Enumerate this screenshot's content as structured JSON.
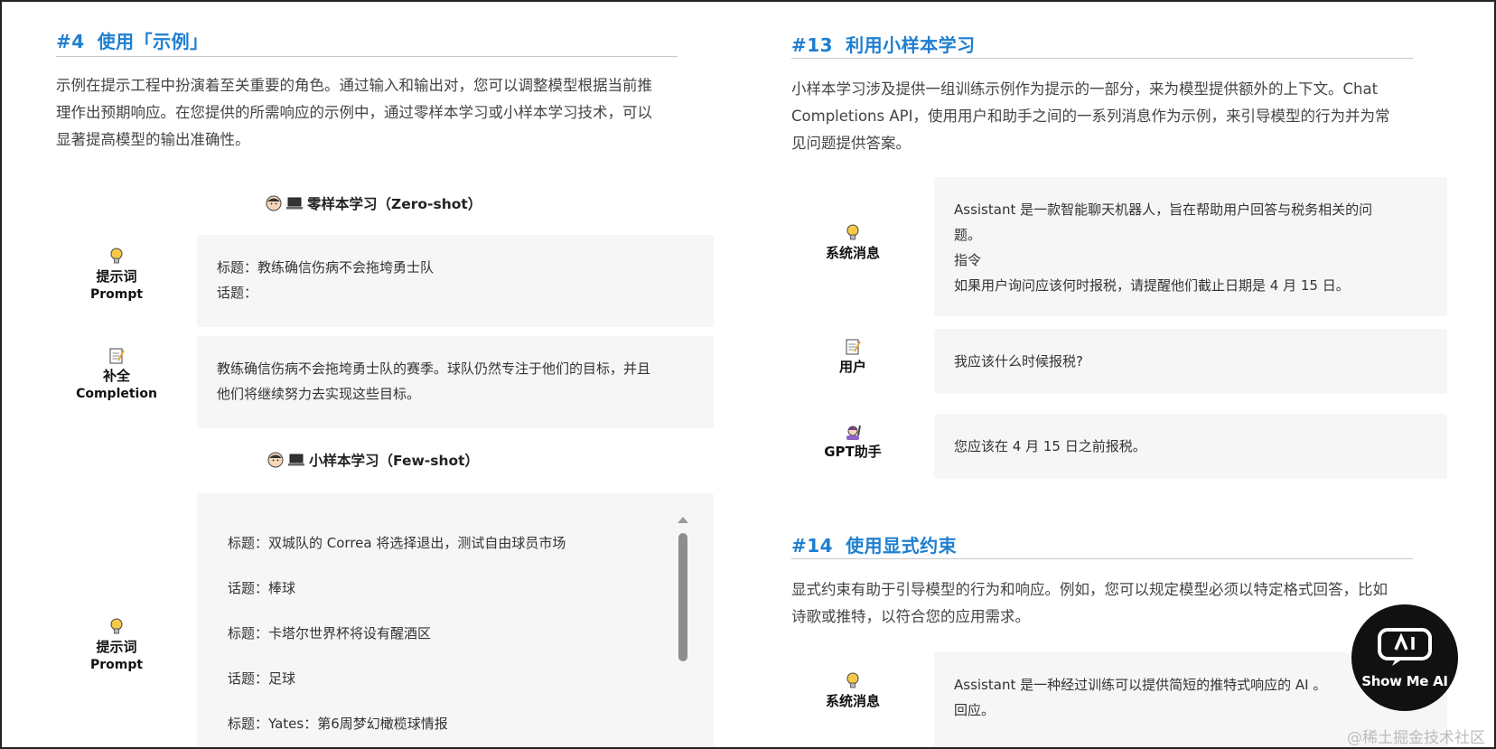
{
  "left": {
    "section": {
      "number": "#4",
      "title": "使用「示例」"
    },
    "intro_lines": [
      "示例在提示工程中扮演着至关重要的角色。通过输入和输出对，您可以调整模型根据当前推",
      "理作出预期响应。在您提供的所需响应的示例中，通过零样本学习或小样本学习技术，可以",
      "显著提高模型的输出准确性。"
    ],
    "zero_shot": {
      "heading": "零样本学习（Zero-shot）",
      "prompt_role": {
        "zh": "提示词",
        "en": "Prompt"
      },
      "prompt_lines": [
        "标题：教练确信伤病不会拖垮勇士队",
        "话题："
      ],
      "completion_role": {
        "zh": "补全",
        "en": "Completion"
      },
      "completion_lines": [
        "教练确信伤病不会拖垮勇士队的赛季。球队仍然专注于他们的目标，并且",
        "他们将继续努力去实现这些目标。"
      ]
    },
    "few_shot": {
      "heading": "小样本学习（Few-shot）",
      "prompt_role": {
        "zh": "提示词",
        "en": "Prompt"
      },
      "prompt_lines": [
        "标题：双城队的 Correa 将选择退出，测试自由球员市场",
        "话题：棒球",
        "标题：卡塔尔世界杯将设有醒酒区",
        "话题：足球",
        "标题：Yates：第6周梦幻橄榄球情报"
      ]
    }
  },
  "right": {
    "section13": {
      "number": "#13",
      "title": "利用小样本学习"
    },
    "intro13_lines": [
      "小样本学习涉及提供一组训练示例作为提示的一部分，来为模型提供额外的上下文。Chat",
      "Completions API，使用用户和助手之间的一系列消息作为示例，来引导模型的行为并为常",
      "见问题提供答案。"
    ],
    "system_role": "系统消息",
    "system_lines": [
      "Assistant 是一款智能聊天机器人，旨在帮助用户回答与税务相关的问",
      "题。",
      "指令",
      "如果用户询问应该何时报税，请提醒他们截止日期是 4 月 15 日。"
    ],
    "user_role": "用户",
    "user_line": "我应该什么时候报税?",
    "assistant_role": "GPT助手",
    "assistant_line": "您应该在 4 月 15 日之前报税。",
    "section14": {
      "number": "#14",
      "title": "使用显式约束"
    },
    "intro14_lines": [
      "显式约束有助于引导模型的行为和响应。例如，您可以规定模型必须以特定格式回答，比如",
      "诗歌或推特，以符合您的应用需求。"
    ],
    "system2_role": "系统消息",
    "system2_lines": [
      "Assistant 是一种经过训练可以提供简短的推特式响应的 AI 。",
      "回应。"
    ]
  },
  "badge": {
    "text": "Show Me AI"
  },
  "watermark": "@稀土掘金技术社区",
  "colors": {
    "accent": "#1f7fd0",
    "box_bg": "#f5f6f5",
    "badge_bg": "#111111"
  }
}
